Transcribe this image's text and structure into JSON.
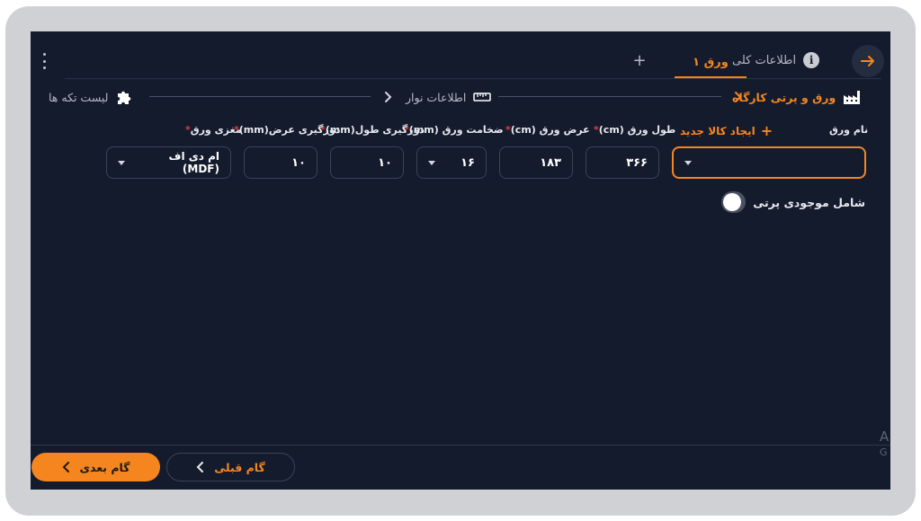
{
  "tabs": {
    "info_label": "اطلاعات کلی",
    "info_icon": "i",
    "sheet_label": "ورق ۱",
    "add_label": "+"
  },
  "breadcrumb": {
    "workshop": "ورق و پرتی کارگاه",
    "tape": "اطلاعات نوار",
    "pieces": "لیست تکه ها"
  },
  "form": {
    "sheet_name_label": "نام ورق",
    "create_item": "ایجاد کالا جدید",
    "length_label": "طول ورق (cm)",
    "width_label": "عرض ورق (cm)",
    "thickness_label": "ضخامت ورق (mm)",
    "edge_length_label": "دورگیری طول(mm)",
    "edge_width_label": "دورگیری عرض(mm)",
    "core_label": "مغزی ورق",
    "required_mark": "*",
    "length_value": "۳۶۶",
    "width_value": "۱۸۳",
    "thickness_value": "۱۶",
    "edge_length_value": "۱۰",
    "edge_width_value": "۱۰",
    "core_value": "ام دی اف (MDF)",
    "include_scrap_label": "شامل موجودی پرتی"
  },
  "footer": {
    "next_label": "گام بعدی",
    "prev_label": "گام قبلی",
    "edge_a": "A",
    "edge_g": "G"
  },
  "colors": {
    "accent": "#f5861f",
    "background": "#141b2d",
    "required": "#e23b3b"
  }
}
